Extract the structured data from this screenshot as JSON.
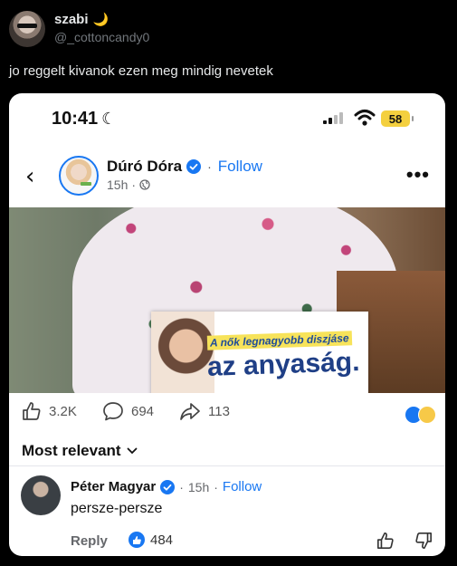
{
  "tweet": {
    "display_name": "szabi",
    "name_emoji": "🌙",
    "handle": "@_cottoncandy0",
    "text": "jo reggelt kivanok ezen meg mindig nevetek"
  },
  "phone_status": {
    "time": "10:41",
    "battery": "58"
  },
  "post": {
    "page_name": "Dúró Dóra",
    "separator": "·",
    "follow_label": "Follow",
    "age": "15h",
    "meta_dot": "·",
    "sign_small_text": "A nők legnagyobb diszjáse",
    "sign_big_text": "az anyaság.",
    "stats": {
      "likes": "3.2K",
      "comments": "694",
      "shares": "113"
    }
  },
  "comments_section": {
    "sort_label": "Most relevant",
    "comment": {
      "author": "Péter Magyar",
      "separator": "·",
      "age": "15h",
      "follow_label": "Follow",
      "text": "persze-persze",
      "reply_label": "Reply",
      "like_count": "484"
    }
  },
  "colors": {
    "facebook_blue": "#1877f2",
    "battery_yellow": "#f4d03f",
    "x_background": "#000000"
  }
}
